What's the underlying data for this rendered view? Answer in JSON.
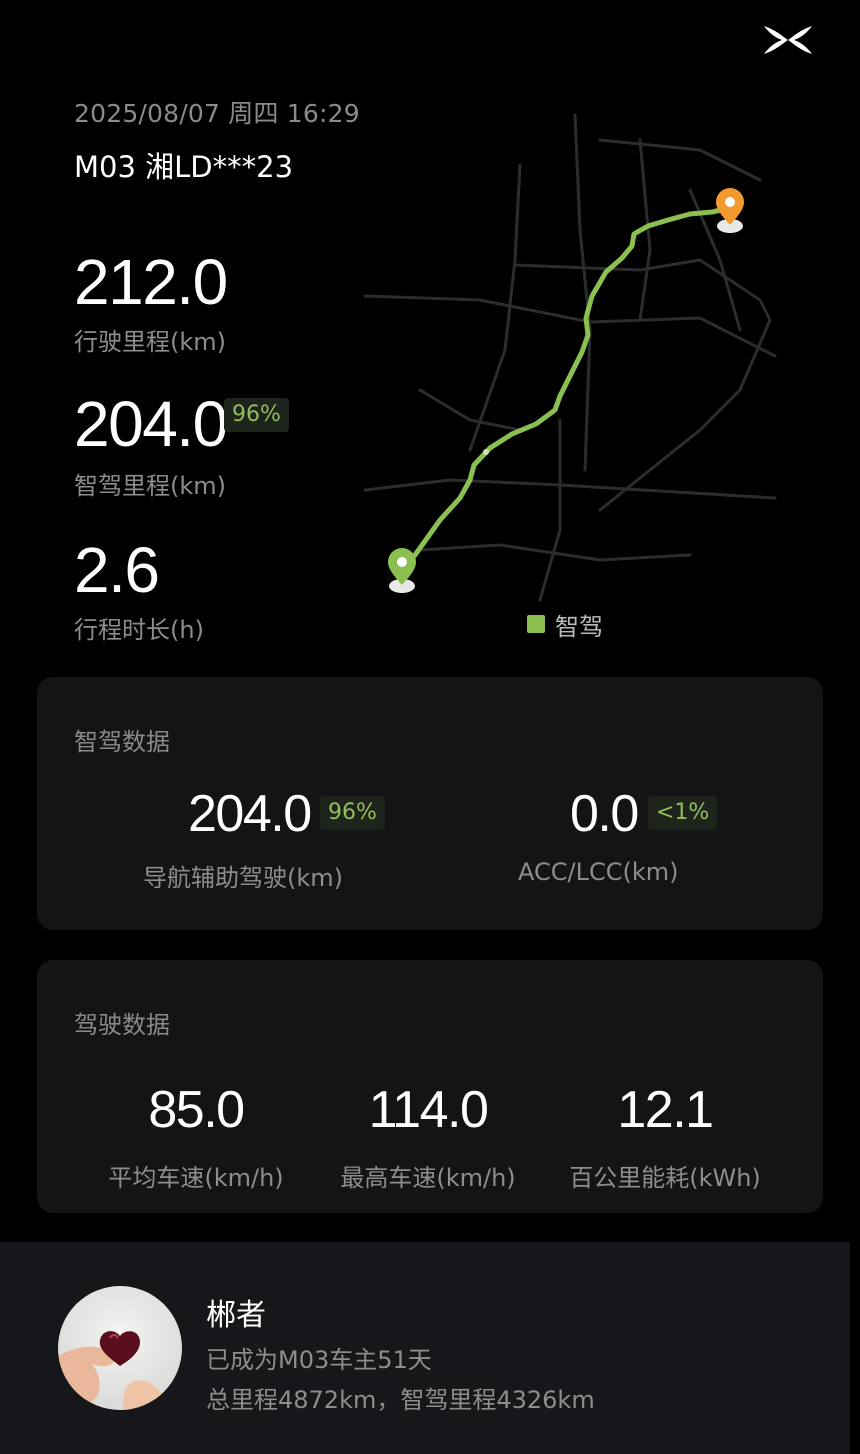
{
  "trip": {
    "datetime": "2025/08/07 周四 16:29",
    "vehicle": "M03 湘LD***23",
    "distance_value": "212.0",
    "distance_label": "行驶里程(km)",
    "smart_value": "204.0",
    "smart_pct": "96%",
    "smart_label": "智驾里程(km)",
    "duration_value": "2.6",
    "duration_label": "行程时长(h)"
  },
  "map": {
    "legend_label": "智驾",
    "route_color": "#8bbf50",
    "start_pin_color": "#8bbf50",
    "end_pin_color": "#f29a2e"
  },
  "smart_card": {
    "title": "智驾数据",
    "nav_value": "204.0",
    "nav_pct": "96%",
    "nav_label": "导航辅助驾驶(km)",
    "acc_value": "0.0",
    "acc_pct": "<1%",
    "acc_label": "ACC/LCC(km)"
  },
  "drive_card": {
    "title": "驾驶数据",
    "avg_speed_value": "85.0",
    "avg_speed_label": "平均车速(km/h)",
    "max_speed_value": "114.0",
    "max_speed_label": "最高车速(km/h)",
    "energy_value": "12.1",
    "energy_label": "百公里能耗(kWh)"
  },
  "profile": {
    "username": "郴者",
    "owner_days": "已成为M03车主51天",
    "totals": "总里程4872km，智驾里程4326km"
  },
  "colors": {
    "accent_green": "#8fbf5a",
    "card_bg": "#131416",
    "page_bg": "#000000"
  }
}
